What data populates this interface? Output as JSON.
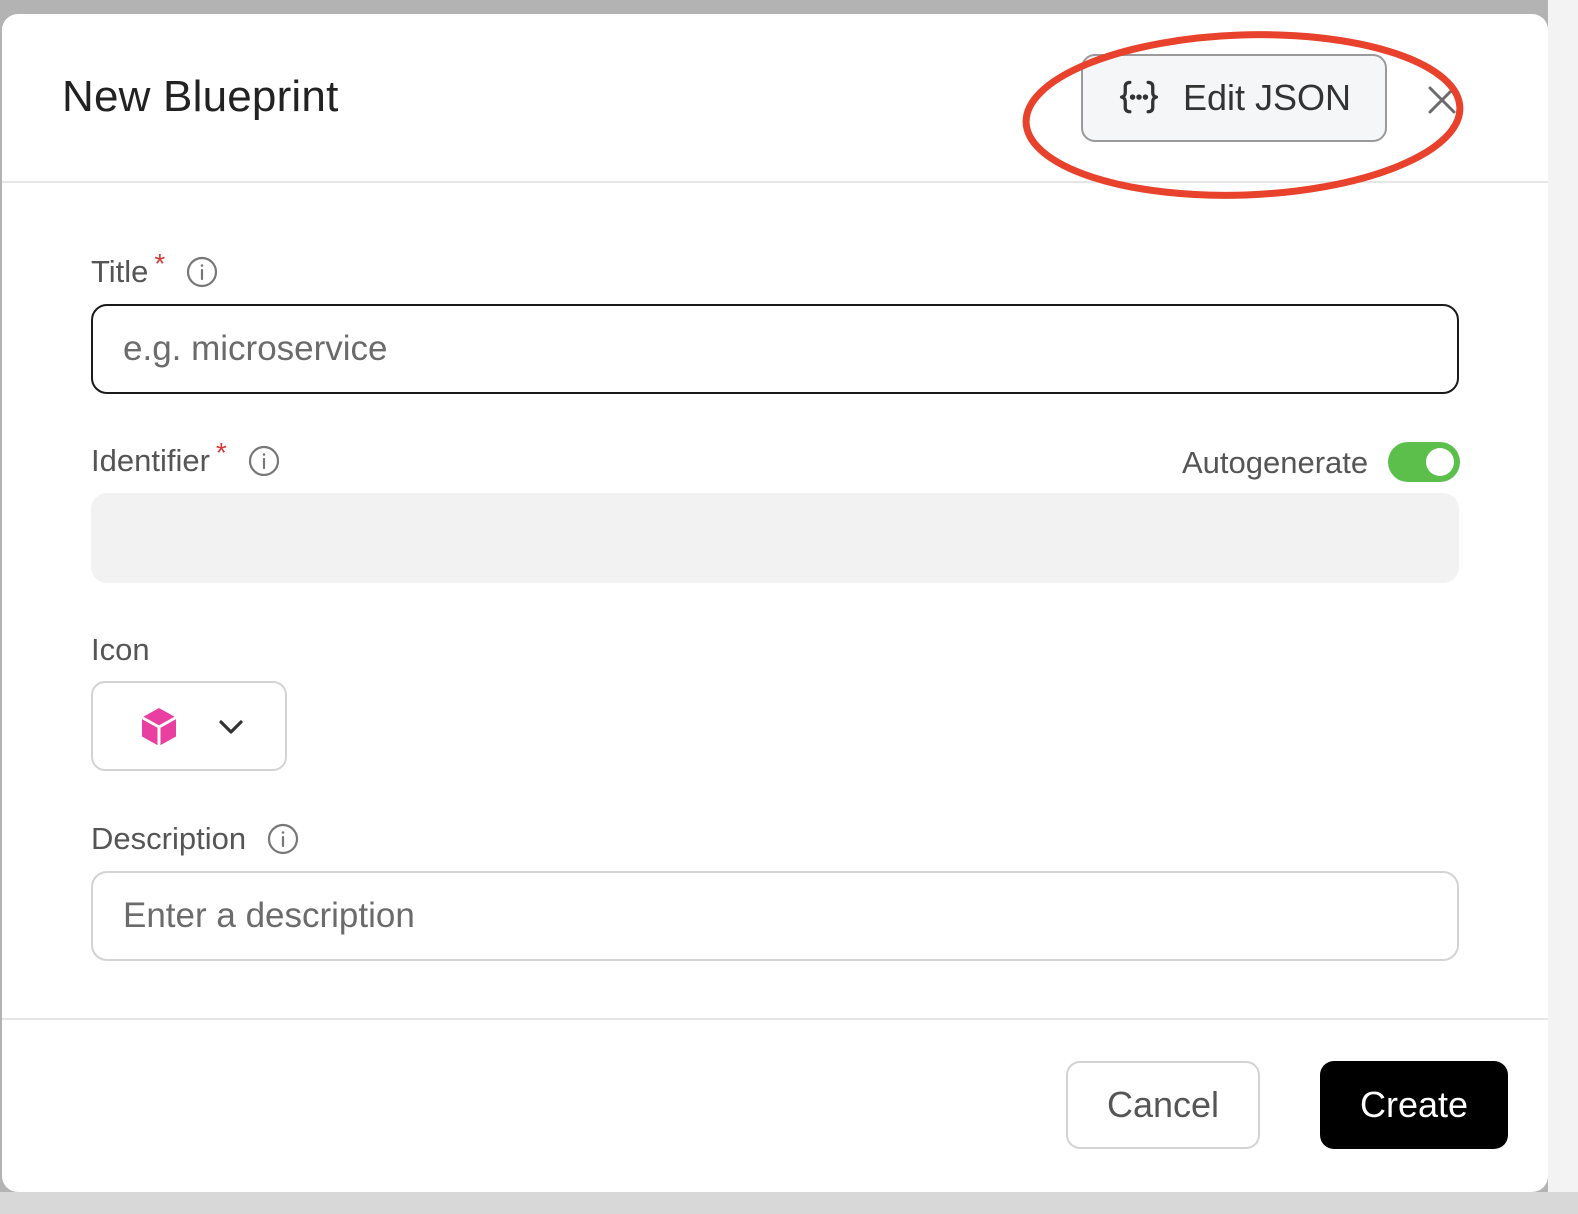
{
  "modal": {
    "title": "New Blueprint",
    "edit_json_label": "Edit JSON",
    "close_icon": "close-icon"
  },
  "form": {
    "title": {
      "label": "Title",
      "required_mark": "*",
      "placeholder": "e.g. microservice",
      "value": ""
    },
    "identifier": {
      "label": "Identifier",
      "required_mark": "*",
      "autogenerate_label": "Autogenerate",
      "autogenerate_on": true,
      "value": ""
    },
    "icon": {
      "label": "Icon",
      "selected_icon": "cube-icon",
      "icon_color": "#e93fa0"
    },
    "description": {
      "label": "Description",
      "placeholder": "Enter a description",
      "value": ""
    }
  },
  "footer": {
    "cancel_label": "Cancel",
    "create_label": "Create"
  },
  "colors": {
    "toggle_on": "#5cbf4c",
    "required": "#d43a3a",
    "highlight": "#e8412c",
    "primary_button": "#000000"
  }
}
